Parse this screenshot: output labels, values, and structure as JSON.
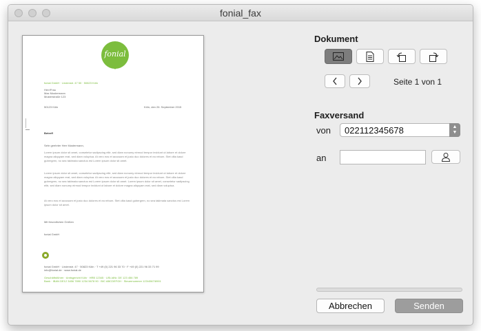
{
  "window": {
    "title": "fonial_fax"
  },
  "document_preview": {
    "logo_text": "fonial",
    "sender_line": "fonial GmbH · Lindenstr. 47 50 · 50823 Köln",
    "recipient": [
      "Herr/Frau",
      "Max Mustermann",
      "Musterstraße 123"
    ],
    "city_zip": "50123 Köln",
    "date": "Köln, den 26. September 2015",
    "subject": "Betreff",
    "salutation": "Sehr geehrter Herr Mustermann,",
    "paragraphs": [
      "Lorem ipsum dolor sit amet, consetetur sadipscing elitr, sed diam nonumy eirmod tempor invidunt ut labore et dolore magna aliquyam erat, sed diam voluptua. At vero eos et accusam et justo duo dolores et ea rebum. Stet clita kasd gubergren, no sea takimata sanctus est Lorem ipsum dolor sit amet.",
      "Lorem ipsum dolor sit amet, consetetur sadipscing elitr, sed diam nonumy eirmod tempor invidunt ut labore et dolore magna aliquyam erat, sed diam voluptua. At vero eos et accusam et justo duo dolores et ea rebum. Stet clita kasd gubergren, no sea takimata sanctus est Lorem ipsum dolor sit amet. Lorem ipsum dolor sit amet, consetetur sadipscing elitr, sed diam nonumy eirmod tempor invidunt ut labore et dolore magna aliquyam erat, sed diam voluptua.",
      "At vero eos et accusam et justo duo dolores et ea rebum. Stet clita kasd gubergren, no sea takimata sanctus est Lorem ipsum dolor sit amet."
    ],
    "closing": "Mit freundlichen Grüßen",
    "signature": "fonial GmbH",
    "footer_lines": [
      "fonial GmbH · Lindenstr. 47 · 50823 Köln · T +49 (0) 221 96 33 70 · F +49 (0) 221 96 33 71 99",
      "info@fonial.de · www.fonial.de",
      "Geschäftsführer · Amtsgericht Köln · HRB 12345 · USt-IdNr. DE 123 456 789",
      "Bank · IBAN DE12 3456 7890 1234 5678 90 · BIC ABCDEFGH · Steuernummer 123/4567/8901"
    ]
  },
  "dokument": {
    "heading": "Dokument",
    "toolbar": [
      {
        "name": "image-view-button",
        "icon": "image-icon",
        "active": true
      },
      {
        "name": "page-view-button",
        "icon": "page-icon",
        "active": false
      },
      {
        "name": "rotate-left-button",
        "icon": "rotate-left-icon",
        "active": false
      },
      {
        "name": "rotate-right-button",
        "icon": "rotate-right-icon",
        "active": false
      }
    ],
    "page_label": "Seite 1 von 1"
  },
  "faxversand": {
    "heading": "Faxversand",
    "von_label": "von",
    "von_value": "022112345678",
    "an_label": "an",
    "an_value": ""
  },
  "progress": 0,
  "buttons": {
    "cancel": "Abbrechen",
    "send": "Senden"
  },
  "colors": {
    "brand_green": "#7cbd3d",
    "active_tool": "#7d7d7d",
    "send_button": "#9d9d9d"
  }
}
